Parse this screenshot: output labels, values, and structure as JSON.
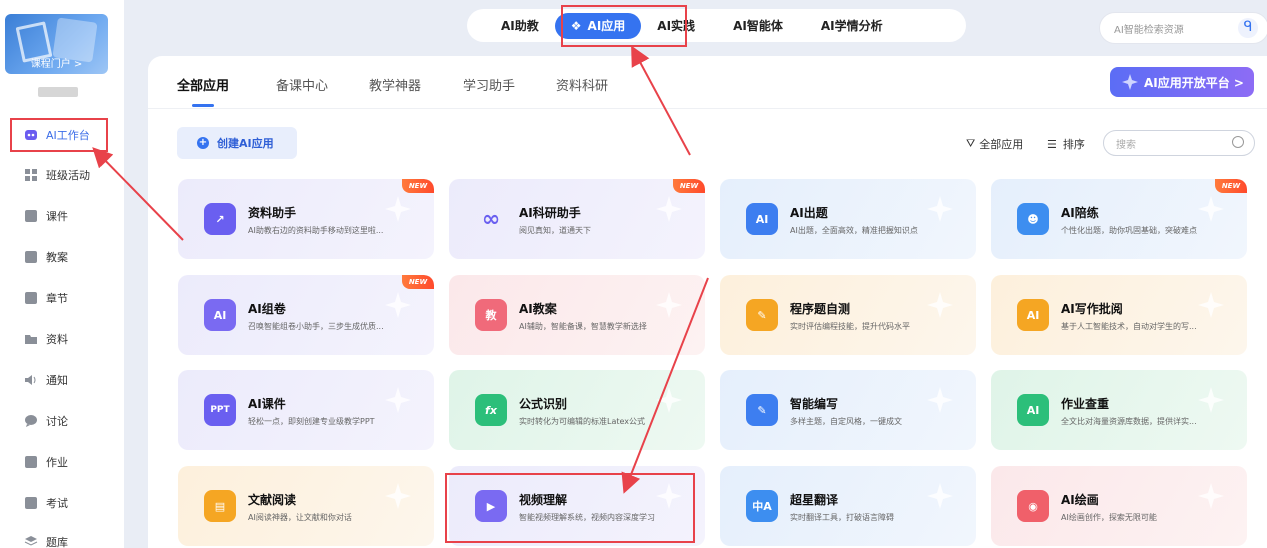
{
  "sidebar": {
    "portal_label": "课程门户 >",
    "items": [
      {
        "label": "AI工作台",
        "icon": "ai-workbench-icon"
      },
      {
        "label": "班级活动",
        "icon": "grid-icon"
      },
      {
        "label": "课件",
        "icon": "courseware-icon"
      },
      {
        "label": "教案",
        "icon": "lesson-plan-icon"
      },
      {
        "label": "章节",
        "icon": "chapter-icon"
      },
      {
        "label": "资料",
        "icon": "folder-icon"
      },
      {
        "label": "通知",
        "icon": "speaker-icon"
      },
      {
        "label": "讨论",
        "icon": "chat-icon"
      },
      {
        "label": "作业",
        "icon": "homework-icon"
      },
      {
        "label": "考试",
        "icon": "exam-icon"
      },
      {
        "label": "题库",
        "icon": "question-bank-icon"
      }
    ]
  },
  "topnav": {
    "tabs": [
      "AI助教",
      "AI应用",
      "AI实践",
      "AI智能体",
      "AI学情分析"
    ],
    "active": "AI应用",
    "search_placeholder": "AI智能检索资源"
  },
  "panel": {
    "subtabs": [
      "全部应用",
      "备课中心",
      "教学神器",
      "学习助手",
      "资料科研"
    ],
    "platform_button": "AI应用开放平台 >",
    "create_button": "创建AI应用",
    "filter_all": "全部应用",
    "sort": "排序",
    "search_placeholder": "搜索"
  },
  "new_badge": "NEW",
  "cards": [
    {
      "title": "资料助手",
      "desc": "AI助教右边的资料助手移动到这里啦...",
      "color": "purple",
      "icon": "chart-icon",
      "new": true
    },
    {
      "title": "AI科研助手",
      "desc": "阅见真知，道通天下",
      "color": "purple",
      "icon": "infinity-icon",
      "new": true
    },
    {
      "title": "AI出题",
      "desc": "AI出题，全面高效，精准把握知识点",
      "color": "blue",
      "icon": "ai-quiz-icon",
      "new": false
    },
    {
      "title": "AI陪练",
      "desc": "个性化出题，助你巩固基础，突破难点",
      "color": "blue",
      "icon": "practice-icon",
      "new": true
    },
    {
      "title": "AI组卷",
      "desc": "召唤智能组卷小助手，三步生成优质...",
      "color": "purple",
      "icon": "layers-icon",
      "new": true
    },
    {
      "title": "AI教案",
      "desc": "AI辅助，智能备课，智慧教学新选择",
      "color": "pink",
      "icon": "teach-icon",
      "new": false
    },
    {
      "title": "程序题自测",
      "desc": "实时评估编程技能，提升代码水平",
      "color": "orange",
      "icon": "code-test-icon",
      "new": false
    },
    {
      "title": "AI写作批阅",
      "desc": "基于人工智能技术，自动对学生的写...",
      "color": "orange",
      "icon": "writing-review-icon",
      "new": false
    },
    {
      "title": "AI课件",
      "desc": "轻松一点，即刻创建专业级教学PPT",
      "color": "purple",
      "icon": "ppt-icon",
      "new": false
    },
    {
      "title": "公式识别",
      "desc": "实时转化为可编辑的标准Latex公式",
      "color": "green",
      "icon": "formula-icon",
      "new": false
    },
    {
      "title": "智能编写",
      "desc": "多样主题，自定风格，一键成文",
      "color": "blue",
      "icon": "edit-icon",
      "new": false
    },
    {
      "title": "作业查重",
      "desc": "全文比对海量资源库数据，提供详实...",
      "color": "green",
      "icon": "plagiarism-icon",
      "new": false
    },
    {
      "title": "文献阅读",
      "desc": "AI阅读神器，让文献和你对话",
      "color": "orange",
      "icon": "book-icon",
      "new": false
    },
    {
      "title": "视频理解",
      "desc": "智能视频理解系统，视频内容深度学习",
      "color": "purple",
      "icon": "video-icon",
      "new": false
    },
    {
      "title": "超星翻译",
      "desc": "实时翻译工具，打破语言障碍",
      "color": "blue",
      "icon": "translate-icon",
      "new": false
    },
    {
      "title": "AI绘画",
      "desc": "AI绘画创作，探索无限可能",
      "color": "pink",
      "icon": "palette-icon",
      "new": false
    }
  ],
  "colors": {
    "accent": "#3573f0",
    "annotation": "#e8424a"
  }
}
